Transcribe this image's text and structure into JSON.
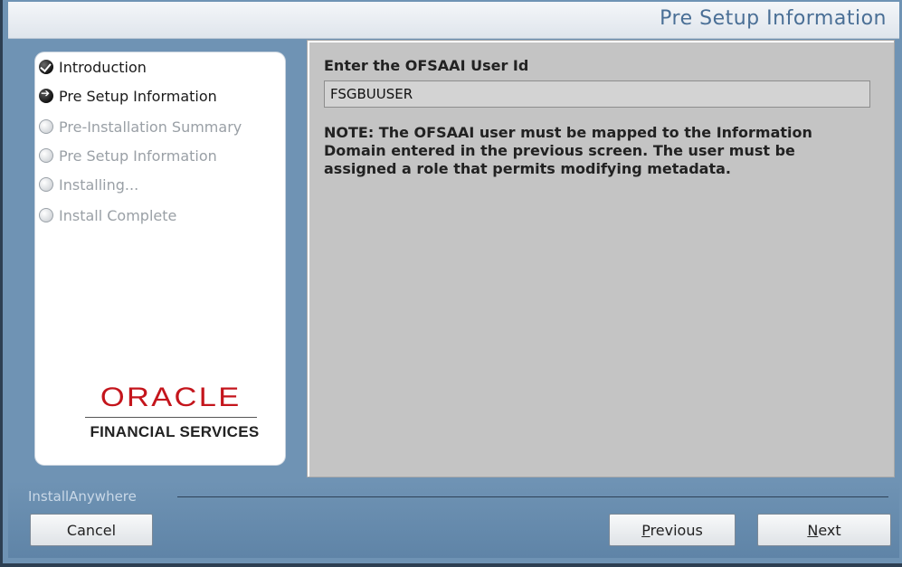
{
  "window": {
    "title": "Pre Setup Information"
  },
  "steps": [
    {
      "label": "Introduction",
      "state": "done"
    },
    {
      "label": "Pre Setup Information",
      "state": "current"
    },
    {
      "label": "Pre-Installation Summary",
      "state": "future"
    },
    {
      "label": "Pre Setup Information",
      "state": "future"
    },
    {
      "label": "Installing...",
      "state": "future"
    },
    {
      "label": "Install Complete",
      "state": "future"
    }
  ],
  "logo": {
    "brand": "ORACLE",
    "tagline": "FINANCIAL SERVICES"
  },
  "form": {
    "user_id_label": "Enter the OFSAAI User Id",
    "user_id_value": "FSGBUUSER",
    "note": "NOTE: The OFSAAI user must be mapped to the Information Domain entered in the previous screen. The user must be assigned a role that permits modifying metadata."
  },
  "footer": {
    "installer": "InstallAnywhere",
    "cancel_label": "Cancel",
    "previous_label": "Previous",
    "next_label": "Next"
  },
  "colors": {
    "frame": "#6f93b4",
    "title": "#4a6f96",
    "brand_red": "#c4151c"
  }
}
